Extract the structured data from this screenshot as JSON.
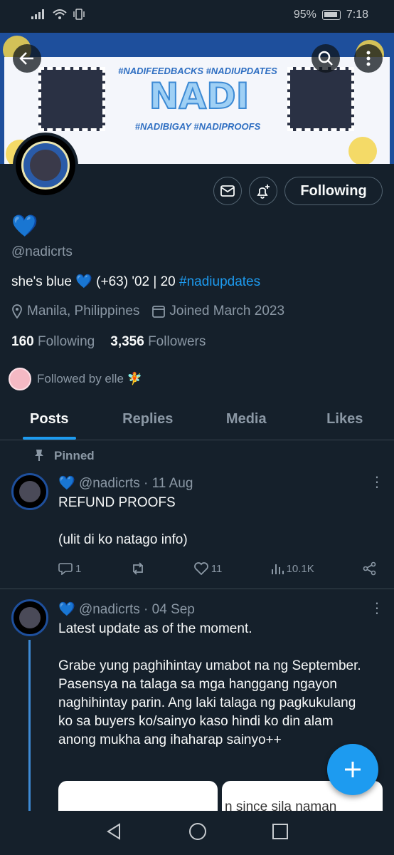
{
  "status_bar": {
    "battery": "95%",
    "time": "7:18"
  },
  "banner": {
    "title": "NADI",
    "tags_top": "#NADIFEEDBACKS #NADIUPDATES",
    "tags_bottom": "#NADIBIGAY #NADIPROOFS"
  },
  "profile": {
    "display_name": "💙",
    "handle": "@nadicrts",
    "bio_text": "she's blue 💙 (+63) '02 | 20 ",
    "bio_hashtag": "#nadiupdates",
    "location": "Manila, Philippines",
    "joined": "Joined March 2023",
    "following_count": "160",
    "following_label": "Following",
    "followers_count": "3,356",
    "followers_label": "Followers",
    "followed_by": "Followed by elle 🧚",
    "follow_button": "Following"
  },
  "tabs": [
    {
      "label": "Posts"
    },
    {
      "label": "Replies"
    },
    {
      "label": "Media"
    },
    {
      "label": "Likes"
    }
  ],
  "tweets": [
    {
      "pinned_label": "Pinned",
      "name": "💙",
      "handle_date": "@nadicrts · 11 Aug",
      "text": "REFUND PROOFS\n\n(ulit di ko natago info)",
      "replies": "1",
      "retweets": "",
      "likes": "11",
      "views": "10.1K"
    },
    {
      "name": "💙",
      "handle_date": "@nadicrts · 04 Sep",
      "text": "Latest update as of the moment.\n\nGrabe yung paghihintay umabot na ng September. Pasensya na talaga sa mga hanggang ngayon naghihintay parin. Ang laki talaga ng pagkukulang ko sa buyers ko/sainyo kaso hindi ko din alam anong mukha ang ihaharap sainyo++",
      "media_snippet": "n since sila naman"
    }
  ],
  "colors": {
    "accent": "#1d9bf0",
    "background": "#15202b",
    "muted": "#8b98a5",
    "border": "#38444d"
  }
}
